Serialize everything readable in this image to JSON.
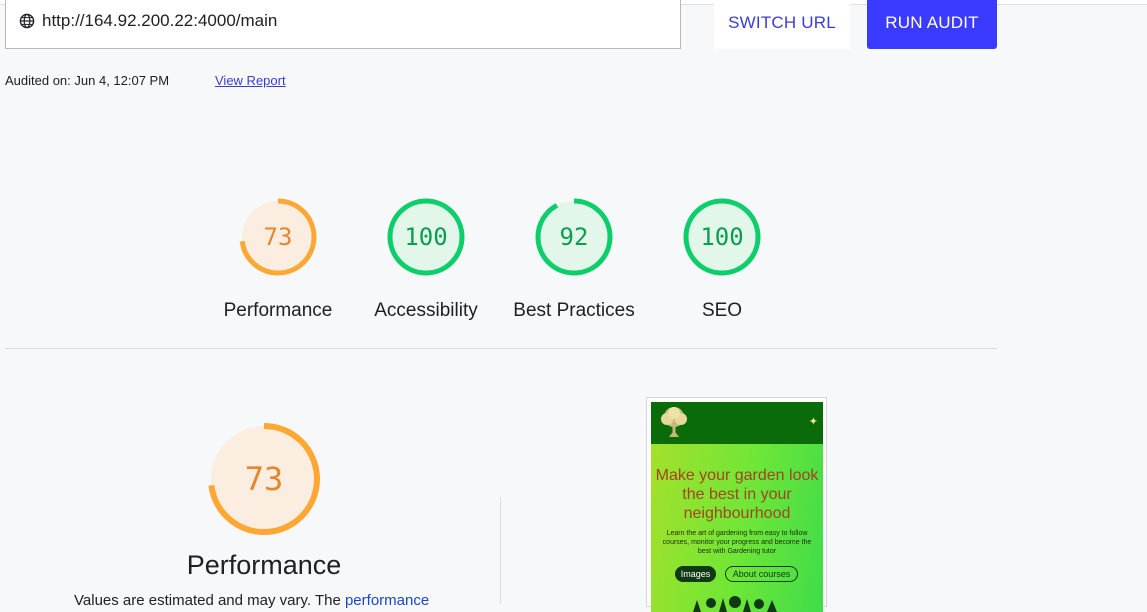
{
  "toolbar": {
    "url": "http://164.92.200.22:4000/main",
    "switch_url_label": "SWITCH URL",
    "run_audit_label": "RUN AUDIT",
    "globe_icon": "globe-icon"
  },
  "meta": {
    "audited_on": "Audited on: Jun 4, 12:07 PM",
    "view_report_label": "View Report"
  },
  "scores": [
    {
      "label": "Performance",
      "score": "73",
      "value": 73,
      "color": "#ffa733",
      "track": "#fbeee0",
      "text_color": "#e6862a"
    },
    {
      "label": "Accessibility",
      "score": "100",
      "value": 100,
      "color": "#0cce6b",
      "track": "#e2f6ea",
      "text_color": "#0a9e50"
    },
    {
      "label": "Best Practices",
      "score": "92",
      "value": 92,
      "color": "#0cce6b",
      "track": "#e2f6ea",
      "text_color": "#0a9e50"
    },
    {
      "label": "SEO",
      "score": "100",
      "value": 100,
      "color": "#0cce6b",
      "track": "#e2f6ea",
      "text_color": "#0a9e50"
    }
  ],
  "performance": {
    "score": "73",
    "value": 73,
    "title": "Performance",
    "desc_prefix": "Values are estimated and may vary. The ",
    "desc_link": "performance"
  },
  "preview": {
    "headline": "Make your garden look the best in your neighbourhood",
    "body": "Learn the art of gardening from easy to follow courses, monitor your progress and become the best with Gardening tutor",
    "button_images": "Images",
    "button_courses": "About courses"
  }
}
